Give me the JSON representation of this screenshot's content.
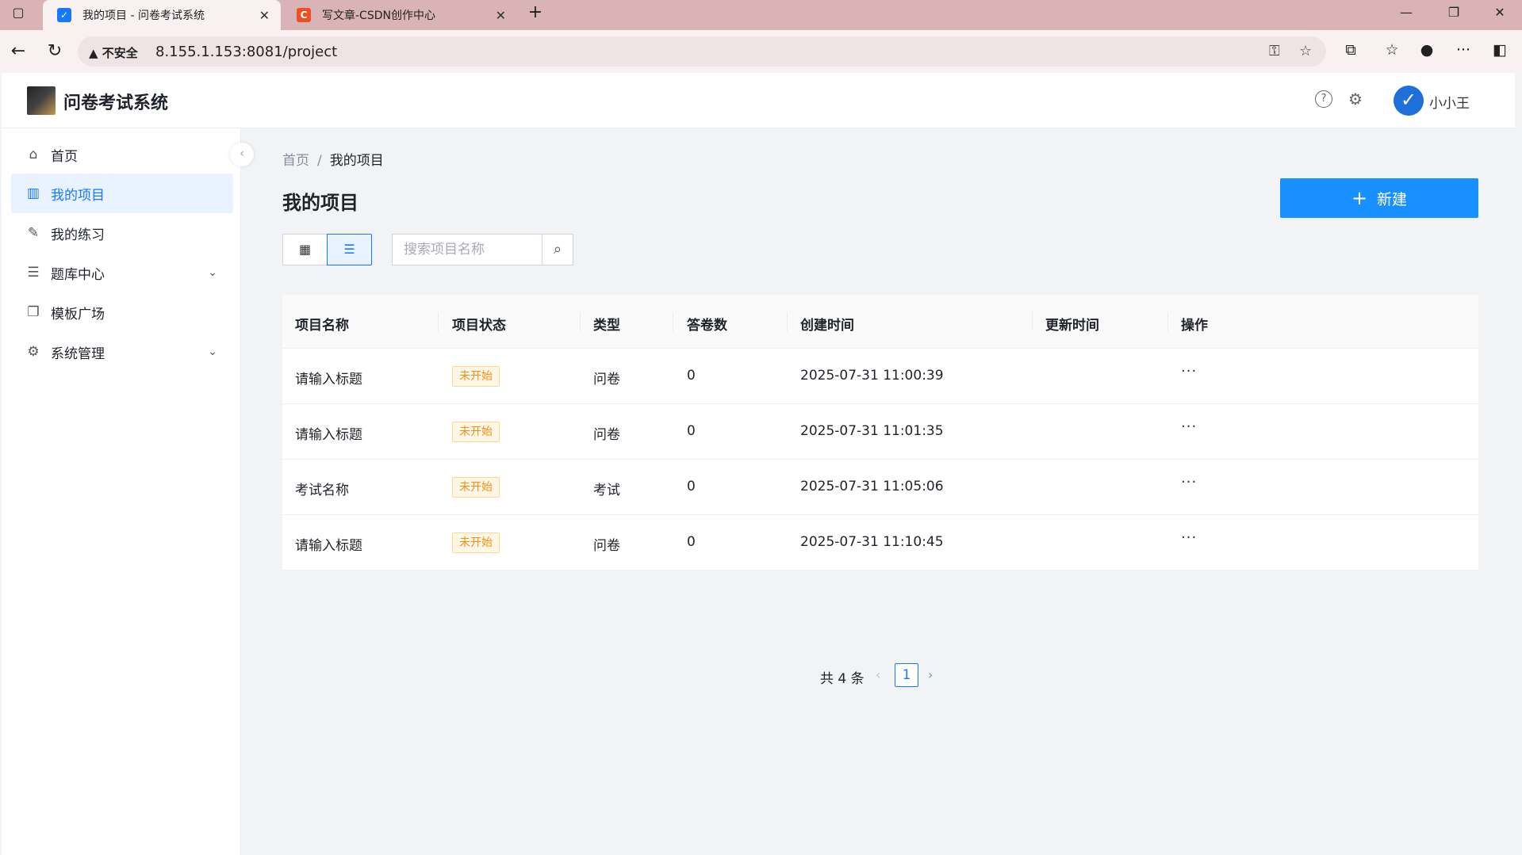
{
  "browser": {
    "tabs": [
      {
        "title": "我的项目 - 问卷考试系统",
        "active": true
      },
      {
        "title": "写文章-CSDN创作中心",
        "active": false
      }
    ],
    "security_label": "不安全",
    "url": "8.155.1.153:8081/project"
  },
  "header": {
    "app_title": "问卷考试系统",
    "username": "小小王"
  },
  "sidebar": {
    "items": [
      {
        "label": "首页",
        "icon": "home-icon"
      },
      {
        "label": "我的项目",
        "icon": "project-icon",
        "active": true
      },
      {
        "label": "我的练习",
        "icon": "edit-icon"
      },
      {
        "label": "题库中心",
        "icon": "database-icon",
        "expandable": true
      },
      {
        "label": "模板广场",
        "icon": "template-icon"
      },
      {
        "label": "系统管理",
        "icon": "gear-icon",
        "expandable": true
      }
    ]
  },
  "main": {
    "breadcrumb": {
      "home": "首页",
      "separator": "/",
      "current": "我的项目"
    },
    "title": "我的项目",
    "new_button": "新建",
    "search_placeholder": "搜索项目名称"
  },
  "table": {
    "columns": [
      "项目名称",
      "项目状态",
      "类型",
      "答卷数",
      "创建时间",
      "更新时间",
      "操作"
    ],
    "rows": [
      {
        "name": "请输入标题",
        "status": "未开始",
        "type": "问卷",
        "responses": "0",
        "created": "2025-07-31 11:00:39",
        "updated": "",
        "action": "···"
      },
      {
        "name": "请输入标题",
        "status": "未开始",
        "type": "问卷",
        "responses": "0",
        "created": "2025-07-31 11:01:35",
        "updated": "",
        "action": "···"
      },
      {
        "name": "考试名称",
        "status": "未开始",
        "type": "考试",
        "responses": "0",
        "created": "2025-07-31 11:05:06",
        "updated": "",
        "action": "···"
      },
      {
        "name": "请输入标题",
        "status": "未开始",
        "type": "问卷",
        "responses": "0",
        "created": "2025-07-31 11:10:45",
        "updated": "",
        "action": "···"
      }
    ]
  },
  "pagination": {
    "total_text": "共 4 条",
    "current_page": "1"
  },
  "colors": {
    "primary": "#1890ff",
    "status_warning": "#fa8c16",
    "tab_bar": "#d9b3b5"
  }
}
